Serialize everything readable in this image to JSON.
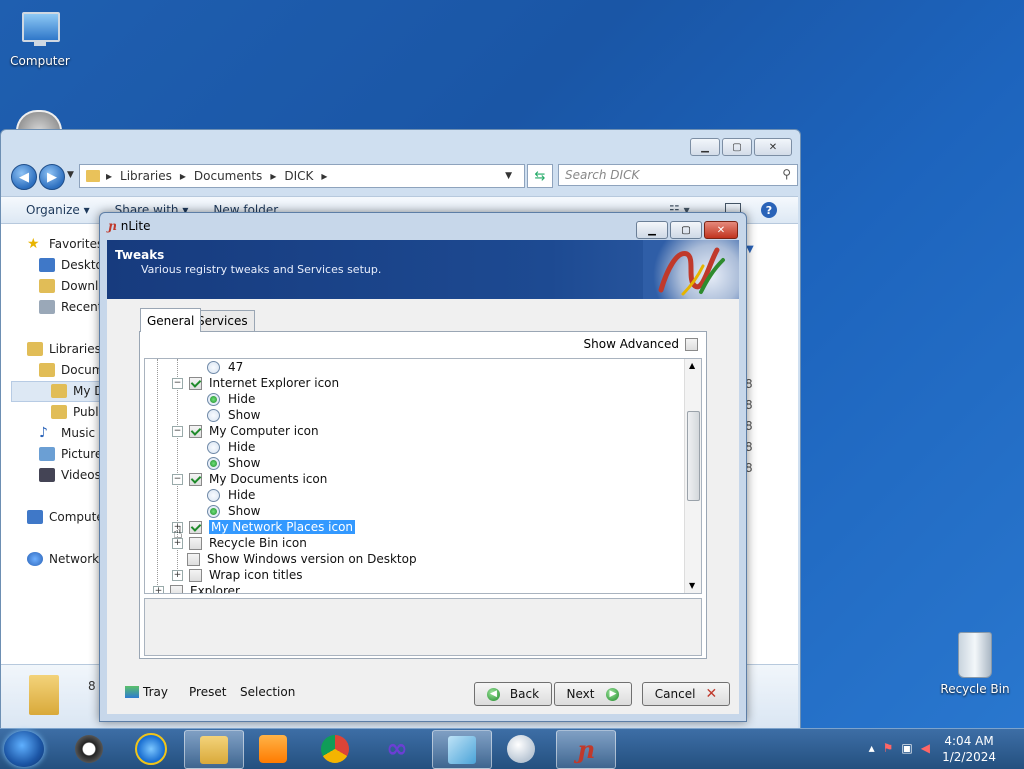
{
  "desktop": {
    "icons": [
      {
        "label": "Computer",
        "icon": "computer-icon"
      },
      {
        "label": "Recycle Bin",
        "icon": "recycle-bin-icon"
      }
    ]
  },
  "explorer": {
    "breadcrumb": [
      "Libraries",
      "Documents",
      "DICK"
    ],
    "search_placeholder": "Search DICK",
    "toolbar": {
      "organize": "Organize",
      "share_with": "Share with",
      "new_folder": "New folder"
    },
    "nav": {
      "favorites": "Favorites",
      "desktop": "Desktop",
      "downloads": "Downlo",
      "recent": "Recent",
      "libraries": "Libraries",
      "documents": "Docum",
      "my_documents": "My D",
      "public": "Publi",
      "music": "Music",
      "pictures": "Picture",
      "videos": "Videos",
      "computer": "Compute",
      "network": "Network"
    },
    "details_count": "8",
    "partial_column_digits": [
      "8",
      "8",
      "8",
      "8",
      "8"
    ]
  },
  "nlite": {
    "window_title": "nLite",
    "banner_title": "Tweaks",
    "banner_subtitle": "Various registry tweaks and Services setup.",
    "tabs": [
      "General",
      "Services"
    ],
    "show_advanced": "Show Advanced",
    "tree": {
      "item_47": "47",
      "ie_icon": "Internet Explorer icon",
      "ie_hide": "Hide",
      "ie_show": "Show",
      "mycomp_icon": "My Computer icon",
      "mycomp_hide": "Hide",
      "mycomp_show": "Show",
      "mydocs_icon": "My Documents icon",
      "mydocs_hide": "Hide",
      "mydocs_show": "Show",
      "netplaces_icon": "My Network Places icon",
      "recycle_icon": "Recycle Bin icon",
      "show_version": "Show Windows version on Desktop",
      "wrap_titles": "Wrap icon titles",
      "explorer": "Explorer"
    },
    "bottom": {
      "tray": "Tray",
      "preset": "Preset",
      "selection": "Selection",
      "back": "Back",
      "next": "Next",
      "cancel": "Cancel"
    }
  },
  "taskbar": {
    "time": "4:04 AM",
    "date": "1/2/2024"
  }
}
